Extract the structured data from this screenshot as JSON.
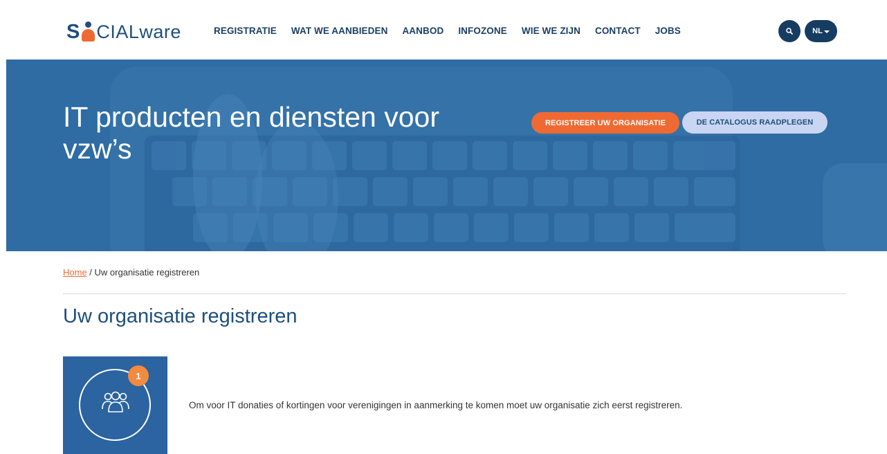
{
  "brand": {
    "logo_s": "S",
    "logo_cial": "CIAL",
    "logo_ware": "ware",
    "colors": {
      "primary": "#1e4f7c",
      "accent": "#ef6a33",
      "hero": "#2c6aa0",
      "tile": "#2b64a0"
    }
  },
  "nav": {
    "items": [
      {
        "label": "REGISTRATIE"
      },
      {
        "label": "WAT WE AANBIEDEN"
      },
      {
        "label": "AANBOD"
      },
      {
        "label": "INFOZONE"
      },
      {
        "label": "WIE WE ZIJN"
      },
      {
        "label": "CONTACT"
      },
      {
        "label": "JOBS"
      }
    ],
    "search_icon": "search-icon",
    "language": "NL"
  },
  "hero": {
    "title": "IT producten en diensten voor vzw’s",
    "primary_button": "REGISTREER UW ORGANISATIE",
    "secondary_button": "DE CATALOGUS RAADPLEGEN"
  },
  "breadcrumb": {
    "home": "Home",
    "separator": " / ",
    "current": "Uw organisatie registreren"
  },
  "page": {
    "title": "Uw organisatie registreren"
  },
  "steps": [
    {
      "number": "1",
      "icon": "users-icon",
      "text": "Om voor IT donaties of kortingen voor verenigingen in aanmerking te komen moet uw organisatie zich eerst registreren."
    }
  ]
}
